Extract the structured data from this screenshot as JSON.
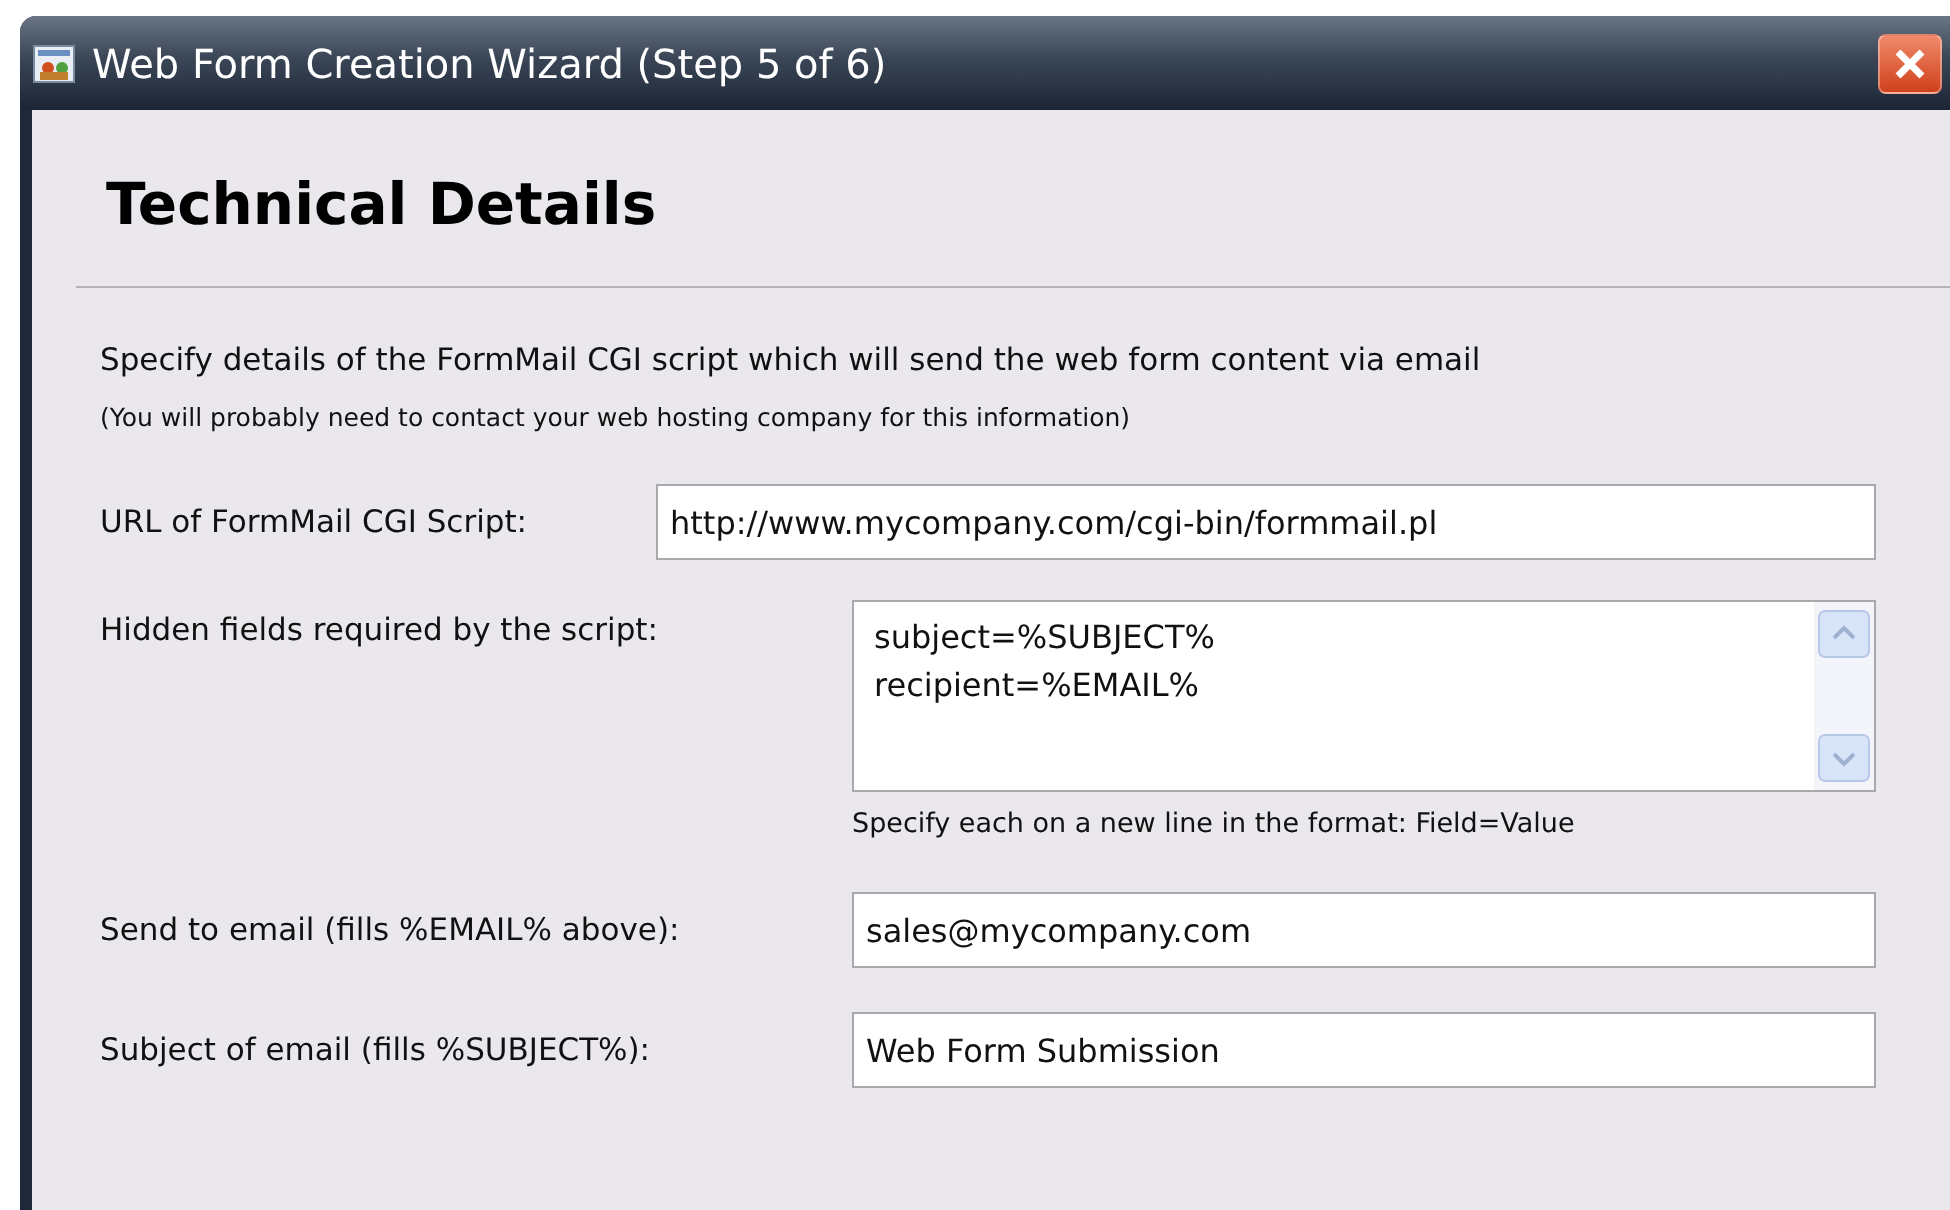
{
  "window": {
    "title": "Web Form Creation Wizard (Step 5 of 6)"
  },
  "heading": "Technical Details",
  "description": "Specify details of the FormMail CGI script which will send the web form content via email",
  "note": "(You will probably need to contact your web hosting company for this information)",
  "url_field": {
    "label": "URL of FormMail CGI Script:",
    "value": "http://www.mycompany.com/cgi-bin/formmail.pl"
  },
  "fields": [
    {
      "kind": "textarea",
      "label": "Hidden fields required by the script:",
      "lines": [
        "subject=%SUBJECT%",
        "recipient=%EMAIL%"
      ],
      "hint": "Specify each on a new line in the format: Field=Value"
    },
    {
      "kind": "text",
      "label": "Send to email (fills %EMAIL% above):",
      "value": "sales@mycompany.com"
    },
    {
      "kind": "text",
      "label": "Subject of email (fills %SUBJECT%):",
      "value": "Web Form Submission"
    }
  ]
}
